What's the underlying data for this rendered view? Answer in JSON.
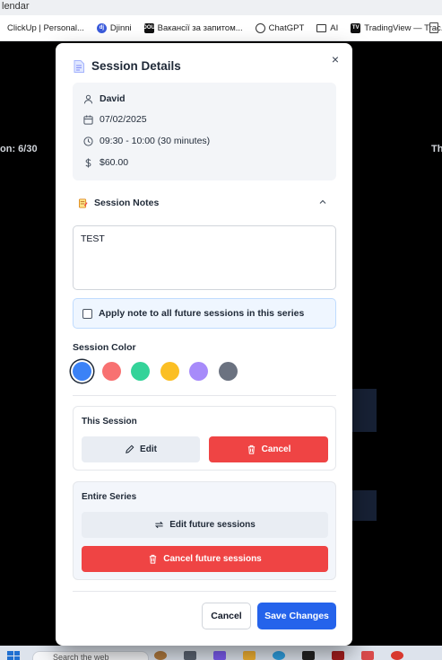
{
  "browser": {
    "tab_title": "lendar",
    "bookmarks": [
      {
        "label": "ClickUp | Personal...",
        "icon": "clickup-icon"
      },
      {
        "label": "Djinni",
        "icon": "djinni-icon"
      },
      {
        "label": "Вакансії за запитом...",
        "icon": "dou-icon"
      },
      {
        "label": "ChatGPT",
        "icon": "chatgpt-icon"
      },
      {
        "label": "AI",
        "icon": "folder-icon"
      },
      {
        "label": "TradingView — Trac...",
        "icon": "tradingview-icon"
      }
    ],
    "favicon_text": {
      "djinni": "dj",
      "dou": "DOU",
      "tradingview": "TV"
    }
  },
  "background": {
    "left_text": "on: 6/30",
    "right_text": "Th"
  },
  "taskbar": {
    "search_placeholder": "Search the web"
  },
  "modal": {
    "title": "Session Details",
    "close_symbol": "×",
    "client": "David",
    "date": "07/02/2025",
    "time": "09:30 - 10:00 (30 minutes)",
    "price": "$60.00",
    "notes_title": "Session Notes",
    "notes_value": "TEST",
    "apply_all_label": "Apply note to all future sessions in this series",
    "apply_all_checked": false,
    "color_label": "Session Color",
    "colors": [
      {
        "name": "blue",
        "hex": "#3b82f6",
        "selected": true
      },
      {
        "name": "red",
        "hex": "#f87171",
        "selected": false
      },
      {
        "name": "green",
        "hex": "#34d399",
        "selected": false
      },
      {
        "name": "yellow",
        "hex": "#fbbf24",
        "selected": false
      },
      {
        "name": "purple",
        "hex": "#a78bfa",
        "selected": false
      },
      {
        "name": "gray",
        "hex": "#6b7280",
        "selected": false
      }
    ],
    "this_session": {
      "title": "This Session",
      "edit_label": "Edit",
      "cancel_label": "Cancel"
    },
    "entire_series": {
      "title": "Entire Series",
      "edit_label": "Edit future sessions",
      "cancel_label": "Cancel future sessions"
    },
    "footer": {
      "cancel_label": "Cancel",
      "save_label": "Save Changes"
    }
  }
}
